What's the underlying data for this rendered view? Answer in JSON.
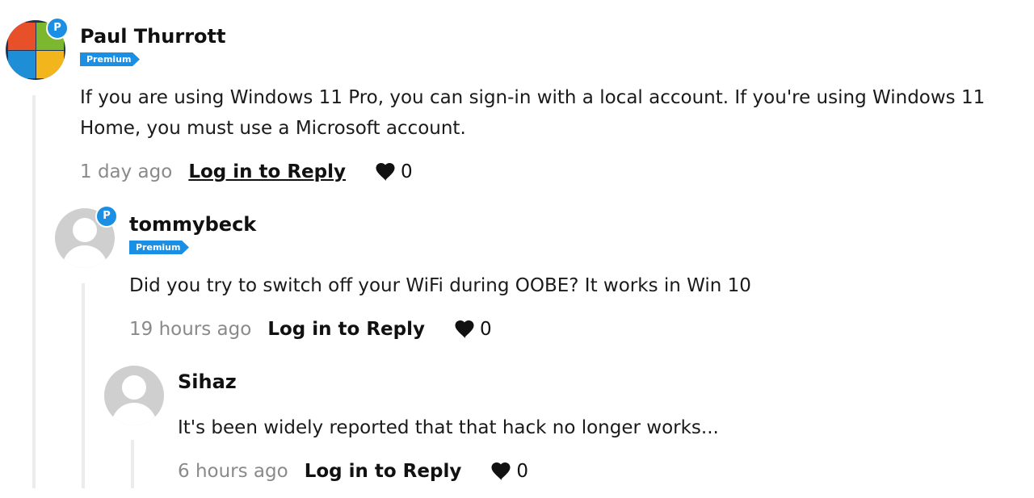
{
  "comments": [
    {
      "author": "Paul Thurrott",
      "badge_letter": "P",
      "badge_label": "Premium",
      "avatar": "windows-logo-avatar",
      "text": "If you are using Windows 11 Pro, you can sign-in with a local account. If you're using Windows 11 Home, you must use a Microsoft account.",
      "time": "1 day ago",
      "reply_label": "Log in to Reply",
      "likes": "0"
    },
    {
      "author": "tommybeck",
      "badge_letter": "P",
      "badge_label": "Premium",
      "avatar": "default-user-avatar",
      "text": "Did you try to switch off your WiFi during OOBE? It works in Win 10",
      "time": "19 hours ago",
      "reply_label": "Log in to Reply",
      "likes": "0"
    },
    {
      "author": "Sihaz",
      "avatar": "default-user-avatar",
      "text": "It's been widely reported that that hack no longer works...",
      "time": "6 hours ago",
      "reply_label": "Log in to Reply",
      "likes": "0"
    }
  ],
  "colors": {
    "accent": "#1a8fe3",
    "thread_line": "#ececec",
    "timestamp": "#8a8a8a",
    "text": "#111111"
  },
  "icons": {
    "like": "heart-icon",
    "premium": "premium-p-badge-icon"
  }
}
